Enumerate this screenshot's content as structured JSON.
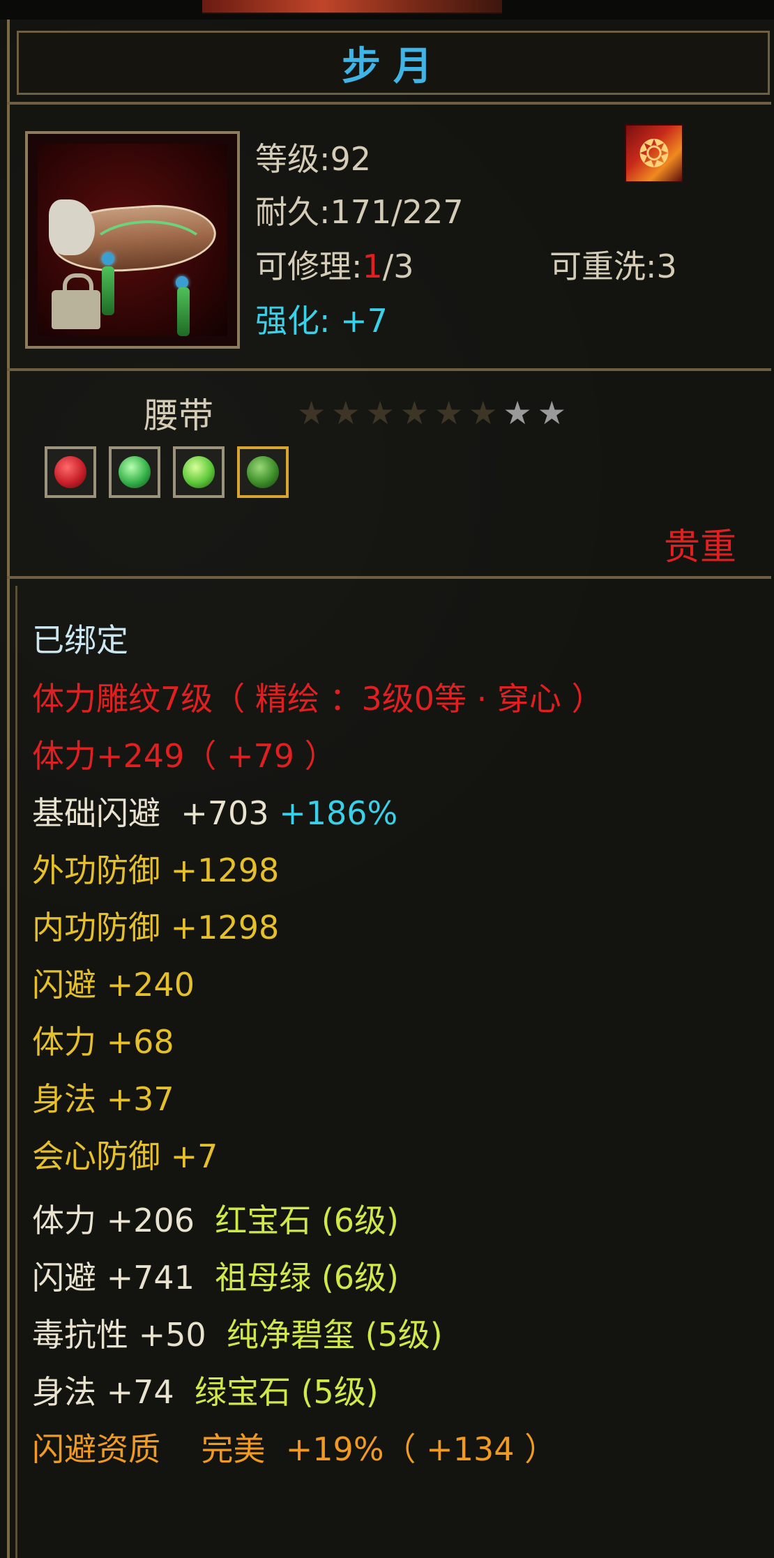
{
  "item": {
    "name": "步月",
    "level_label": "等级:92",
    "durability_label": "耐久:171/227",
    "repair_prefix": "可修理:",
    "repair_used": "1",
    "repair_total": "/3",
    "rewash_label": "可重洗:3",
    "enhance_label": "强化:",
    "enhance_value": "+7",
    "type": "腰带",
    "stars_total": 8,
    "stars_lit": 2,
    "rarity": "贵重",
    "class_icon": "flame-class-icon"
  },
  "sockets": [
    {
      "icon": "ruby-gem-icon",
      "color": "#c8202a"
    },
    {
      "icon": "emerald-gem-icon",
      "color": "#36b24a"
    },
    {
      "icon": "green-gem-icon",
      "color": "#5ec83a"
    },
    {
      "icon": "jade-gem-icon",
      "color": "#3e8e2a"
    }
  ],
  "attributes": {
    "bound": "已绑定",
    "engrave": "体力雕纹7级（ 精绘 ：3级0等 · 穿心 ）",
    "stamina_main": "体力+249（ +79 ）",
    "base_dodge_name": "基础闪避",
    "base_dodge_value": "+703",
    "base_dodge_pct": "+186%",
    "outer_def": "外功防御 +1298",
    "inner_def": "内功防御 +1298",
    "dodge": "闪避 +240",
    "stamina": "体力 +68",
    "agility": "身法 +37",
    "crit_def": "会心防御 +7",
    "gem1_stat": "体力 +206",
    "gem1_name": "红宝石 (6级)",
    "gem2_stat": "闪避 +741",
    "gem2_name": "祖母绿 (6级)",
    "gem3_stat": "毒抗性 +50",
    "gem3_name": "纯净碧玺 (5级)",
    "gem4_stat": "身法 +74",
    "gem4_name": "绿宝石 (5级)",
    "aptitude_name": "闪避资质",
    "aptitude_grade": "完美",
    "aptitude_value": "+19%（ +134 ）"
  }
}
